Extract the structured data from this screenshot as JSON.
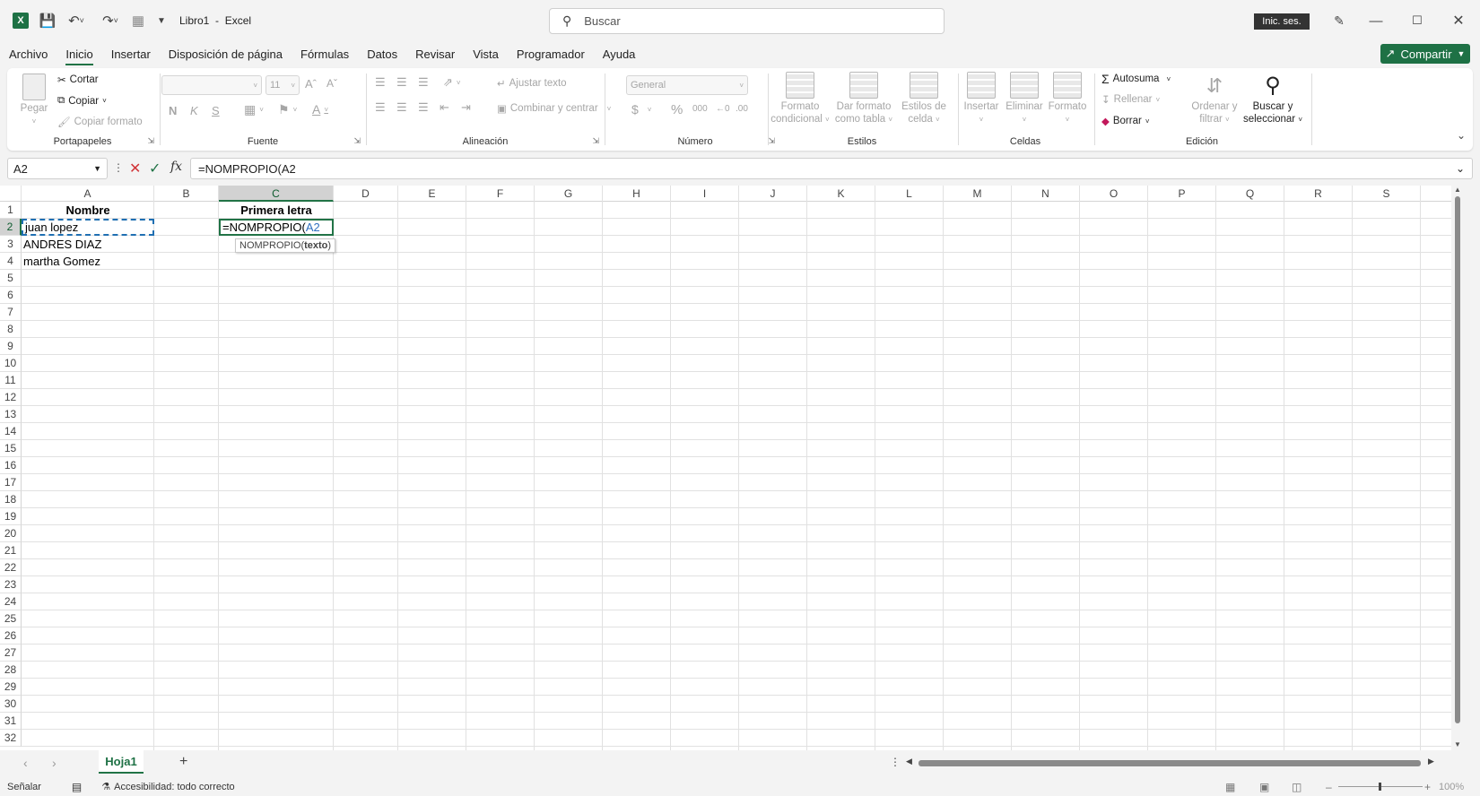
{
  "app": {
    "title": "Libro1  -  Excel",
    "signin": "Inic. ses.",
    "search_placeholder": "Buscar"
  },
  "menu": [
    "Archivo",
    "Inicio",
    "Insertar",
    "Disposición de página",
    "Fórmulas",
    "Datos",
    "Revisar",
    "Vista",
    "Programador",
    "Ayuda"
  ],
  "menu_active": "Inicio",
  "share_label": "Compartir",
  "ribbon": {
    "clipboard": {
      "label": "Portapapeles",
      "paste": "Pegar",
      "cut": "Cortar",
      "copy": "Copiar",
      "format_painter": "Copiar formato"
    },
    "font": {
      "label": "Fuente",
      "size": "11",
      "bold": "N",
      "italic": "K",
      "underline": "S"
    },
    "alignment": {
      "label": "Alineación",
      "wrap": "Ajustar texto",
      "merge": "Combinar y centrar"
    },
    "number": {
      "label": "Número",
      "format": "General"
    },
    "styles": {
      "label": "Estilos",
      "conditional": [
        "Formato",
        "condicional"
      ],
      "table": [
        "Dar formato",
        "como tabla"
      ],
      "cell": [
        "Estilos de",
        "celda"
      ]
    },
    "cells": {
      "label": "Celdas",
      "insert": "Insertar",
      "delete": "Eliminar",
      "format": "Formato"
    },
    "editing": {
      "label": "Edición",
      "autosum": "Autosuma",
      "fill": "Rellenar",
      "clear": "Borrar",
      "sort": [
        "Ordenar y",
        "filtrar"
      ],
      "find": [
        "Buscar y",
        "seleccionar"
      ]
    }
  },
  "formula_bar": {
    "name_box": "A2",
    "formula": "=NOMPROPIO(A2"
  },
  "columns": [
    "A",
    "B",
    "C",
    "D",
    "E",
    "F",
    "G",
    "H",
    "I",
    "J",
    "K",
    "L",
    "M",
    "N",
    "O",
    "P",
    "Q",
    "R",
    "S"
  ],
  "rows": [
    "1",
    "2",
    "3",
    "4",
    "5",
    "6",
    "7",
    "8",
    "9",
    "10",
    "11",
    "12",
    "13",
    "14",
    "15",
    "16",
    "17",
    "18",
    "19",
    "20",
    "21",
    "22",
    "23",
    "24",
    "25",
    "26",
    "27",
    "28",
    "29",
    "30",
    "31",
    "32"
  ],
  "cells": {
    "A1": "Nombre",
    "C1": "Primera letra",
    "A2": "juan lopez",
    "A3": "ANDRES DIAZ",
    "A4": "martha Gomez",
    "C2_prefix": "=NOMPROPIO(",
    "C2_ref": "A2"
  },
  "tooltip": {
    "fn": "NOMPROPIO(",
    "arg": "texto",
    "close": ")"
  },
  "sheets": [
    "Hoja1"
  ],
  "status": {
    "mode": "Señalar",
    "accessibility": "Accesibilidad: todo correcto",
    "zoom": "100%"
  },
  "colors": {
    "accent": "#217346",
    "share": "#1e7145",
    "ref_blue": "#2f6fc0"
  }
}
